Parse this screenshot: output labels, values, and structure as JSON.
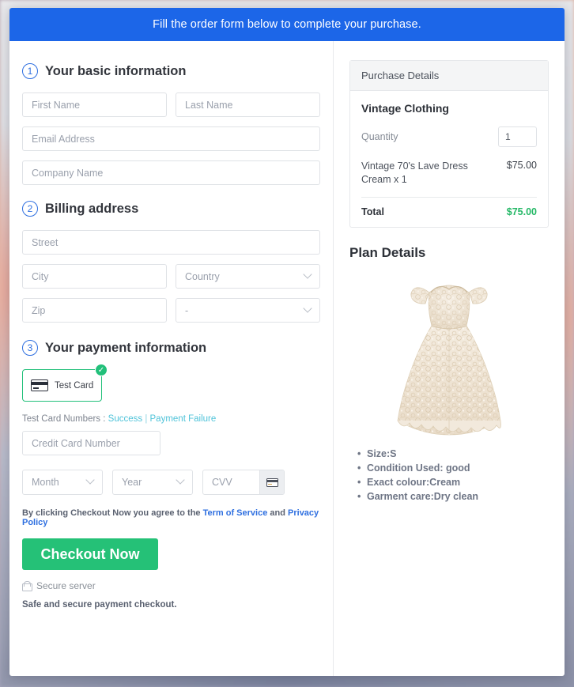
{
  "banner": {
    "text": "Fill the order form below to complete your purchase."
  },
  "sections": {
    "basic": {
      "number": "1",
      "title": "Your basic information",
      "fields": {
        "first_name": "First Name",
        "last_name": "Last Name",
        "email": "Email Address",
        "company": "Company Name"
      }
    },
    "billing": {
      "number": "2",
      "title": "Billing address",
      "fields": {
        "street": "Street",
        "city": "City",
        "country": "Country",
        "zip": "Zip",
        "state": "-"
      }
    },
    "payment": {
      "number": "3",
      "title": "Your payment information",
      "card_option_label": "Test  Card",
      "card_icon": "credit-card-icon",
      "selected_badge": "✓",
      "test_prefix": "Test Card Numbers : ",
      "test_success": "Success",
      "test_separator": " | ",
      "test_failure": "Payment Failure",
      "credit_card_number": "Credit Card Number",
      "month": "Month",
      "year": "Year",
      "cvv": "CVV",
      "cvv_icon": "credit-card-icon",
      "terms_prefix": "By clicking Checkout Now you agree to the ",
      "terms_link1": "Term of Service",
      "terms_middle": " and ",
      "terms_link2": "Privacy Policy",
      "checkout_label": "Checkout Now",
      "lock_icon": "lock-icon",
      "secure_label": "Secure server",
      "safe_note": "Safe and secure payment checkout."
    }
  },
  "purchase": {
    "header": "Purchase Details",
    "product_name": "Vintage Clothing",
    "quantity_label": "Quantity",
    "quantity_value": "1",
    "line_item_name": "Vintage 70's Lave Dress Cream x 1",
    "line_item_price": "$75.00",
    "total_label": "Total",
    "total_amount": "$75.00"
  },
  "plan": {
    "title": "Plan Details",
    "image_alt": "vintage-cream-lace-dress-image",
    "bullets": [
      "Size:S",
      "Condition Used: good",
      "Exact colour:Cream",
      "Garment care:Dry clean"
    ]
  },
  "colors": {
    "banner_blue": "#1c66e8",
    "accent_blue": "#2e6fe0",
    "success_green": "#25c177",
    "total_green": "#24b866",
    "link_cyan": "#4fc3d9"
  }
}
